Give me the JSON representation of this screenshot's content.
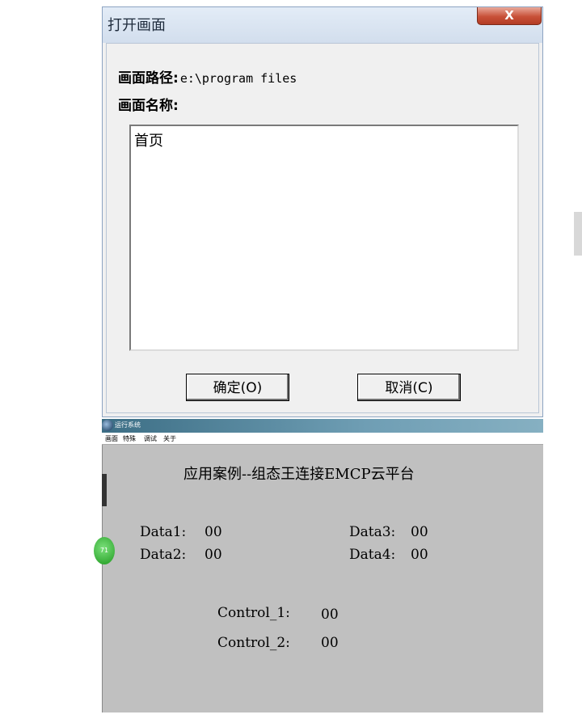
{
  "dialog": {
    "title": "打开画面",
    "close_label": "X",
    "path_label": "画面路径:",
    "path_value": "e:\\program files",
    "name_label": "画面名称:",
    "screens": [
      "首页"
    ],
    "ok_label": "确定(O)",
    "cancel_label": "取消(C)"
  },
  "runtime": {
    "window_title": "运行系统",
    "menu": [
      "画面",
      "特殊",
      "调试",
      "关于"
    ],
    "heading": "应用案例--组态王连接EMCP云平台",
    "data": [
      {
        "label": "Data1:",
        "value": "00"
      },
      {
        "label": "Data2:",
        "value": "00"
      },
      {
        "label": "Data3:",
        "value": "00"
      },
      {
        "label": "Data4:",
        "value": "00"
      }
    ],
    "controls": [
      {
        "label": "Control_1:",
        "value": "00"
      },
      {
        "label": "Control_2:",
        "value": "00"
      }
    ],
    "badge_text": "71"
  }
}
